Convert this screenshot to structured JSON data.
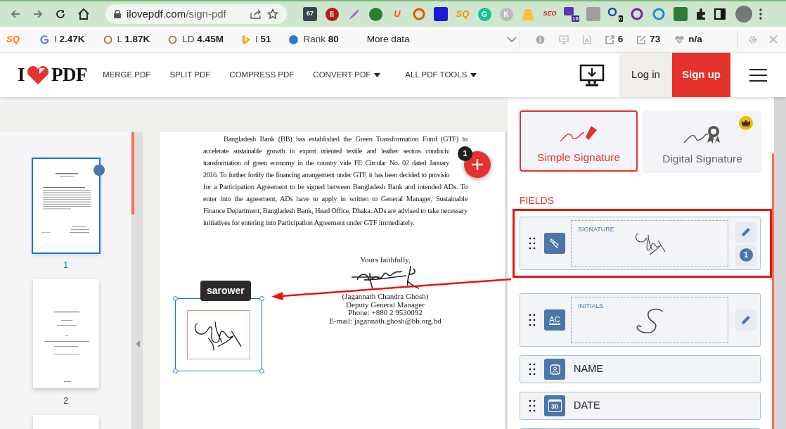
{
  "browser": {
    "url_host": "ilovepdf.com",
    "url_path": "/sign-pdf",
    "extensions": [
      {
        "kind": "tile",
        "color": "#37474f",
        "text": "67"
      },
      {
        "kind": "circle",
        "color": "#b71c1c",
        "text": "fi"
      },
      {
        "kind": "feather",
        "color": "#9c6ade"
      },
      {
        "kind": "circle",
        "color": "#2e7d32"
      },
      {
        "kind": "letter",
        "color": "#ff5722",
        "text": "U"
      },
      {
        "kind": "ring",
        "color": "#e65100"
      },
      {
        "kind": "tile",
        "color": "#1a1ad8"
      },
      {
        "kind": "letter",
        "color": "#ff8f00",
        "text": "SQ"
      },
      {
        "kind": "circle",
        "color": "#15c39a",
        "text": "G"
      },
      {
        "kind": "circle",
        "color": "#bdbdbd",
        "text": "K"
      },
      {
        "kind": "cone",
        "color": "#fbc02d"
      },
      {
        "kind": "letter",
        "color": "#c62828",
        "text": "SEO"
      },
      {
        "kind": "tile",
        "color": "#5e35b1",
        "badge": "10"
      },
      {
        "kind": "tile",
        "color": "#9e9e9e"
      },
      {
        "kind": "ring",
        "color": "#1e4fa0",
        "badge": "0"
      },
      {
        "kind": "ring",
        "color": "#7b1fa2"
      },
      {
        "kind": "ring",
        "color": "#1e88e5"
      },
      {
        "kind": "tile",
        "color": "#2e7d32"
      }
    ]
  },
  "seo_bar": {
    "logo": "SQ",
    "metrics": [
      {
        "label": "I",
        "value": "2.47K"
      },
      {
        "label": "L",
        "value": "1.87K"
      },
      {
        "label": "LD",
        "value": "4.45M"
      },
      {
        "label": "I",
        "value": "51"
      },
      {
        "label": "Rank",
        "value": "80"
      }
    ],
    "more": "More data",
    "stats": [
      {
        "value": "6"
      },
      {
        "value": "73"
      },
      {
        "value": "n/a"
      }
    ]
  },
  "site_header": {
    "logo_left": "I",
    "logo_right": "PDF",
    "nav": [
      {
        "label": "MERGE PDF",
        "dropdown": false
      },
      {
        "label": "SPLIT PDF",
        "dropdown": false
      },
      {
        "label": "COMPRESS PDF",
        "dropdown": false
      },
      {
        "label": "CONVERT PDF",
        "dropdown": true
      },
      {
        "label": "ALL PDF TOOLS",
        "dropdown": true
      }
    ],
    "login": "Log in",
    "signup": "Sign up"
  },
  "thumbnails": [
    {
      "page": "1",
      "kind": "letter",
      "selected": true,
      "marked": true
    },
    {
      "page": "2",
      "kind": "cover",
      "selected": false,
      "marked": false
    },
    {
      "kind": "cover",
      "selected": false,
      "marked": false
    }
  ],
  "document": {
    "lines": [
      "Bangladesh Bank (BB) has established the Green Transformation Fund  (GTF) to",
      "accelerate  sustainable  growth in export oriented textile and leather sectors  conduciv",
      "transformation of green economy in the country vide FE Circular No. 02 dated January",
      "2016. To further fortify the financing arrangement under GTF, it has been decided to provisio",
      "for a Participation Agreement to be signed between Bangladesh Bank and intended ADs. To",
      "enter into the agreement, ADs have to apply in written to General Manager, Sustainable",
      "Finance Department, Bangladesh Bank, Head Office, Dhaka. ADs are advised to take necessary",
      "initiatives for entering into Participation Agreement under GTF immediately."
    ],
    "closing": "Yours faithfully,",
    "signer": [
      "(Jagannath Chandra Ghosh)",
      "Deputy General Manager",
      "Phone: +880 2 9530092",
      "E-mail: jagannath.ghosh@bb.org.bd"
    ],
    "placed_signature": {
      "owner": "sarower",
      "selected": true
    },
    "add_button": {
      "count": "1"
    }
  },
  "panel": {
    "modes": [
      {
        "label": "Simple Signature",
        "selected": true,
        "premium": false
      },
      {
        "label": "Digital Signature",
        "selected": false,
        "premium": true
      }
    ],
    "fields_title": "FIELDS",
    "fields": [
      {
        "kind": "signature",
        "label": "SIGNATURE",
        "count": "1",
        "highlighted": true
      },
      {
        "kind": "initials",
        "label": "INITIALS",
        "icon_text": "AC",
        "highlighted": false
      },
      {
        "kind": "name",
        "label": "NAME",
        "highlighted": false
      },
      {
        "kind": "date",
        "label": "DATE",
        "icon_text": "30",
        "highlighted": false
      }
    ]
  }
}
